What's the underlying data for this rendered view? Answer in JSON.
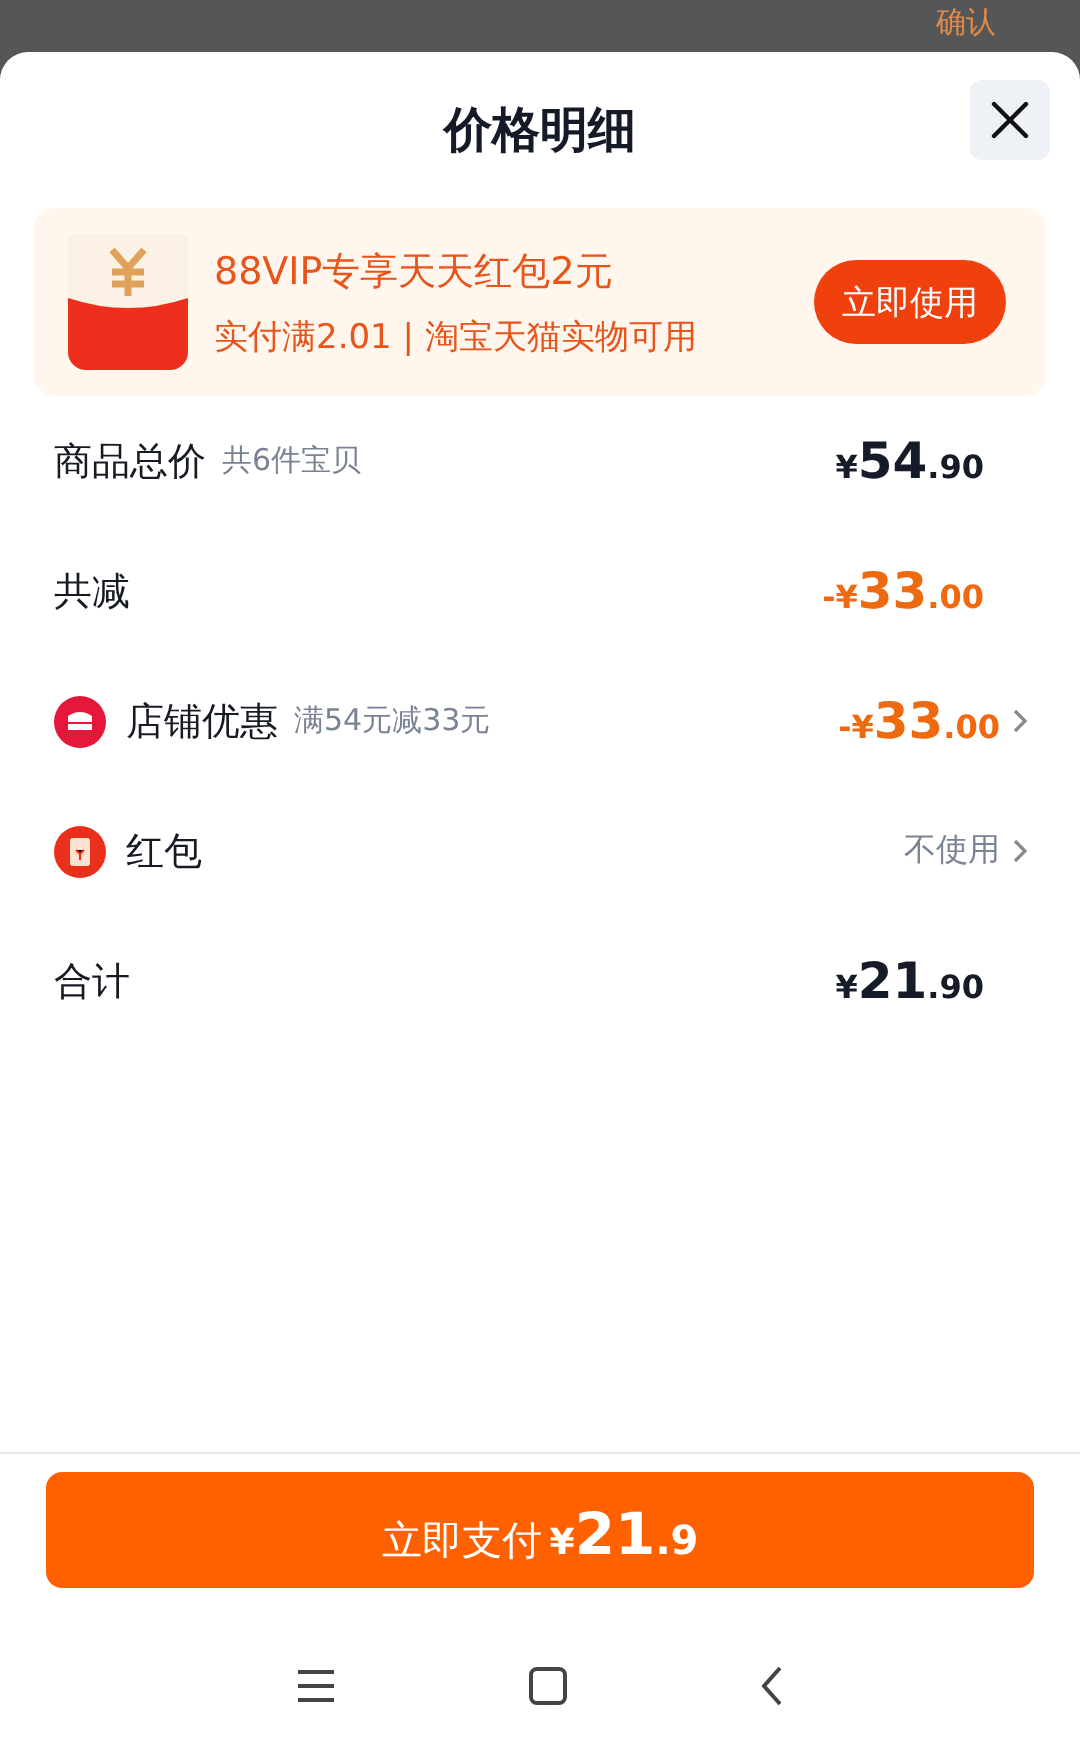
{
  "background": {
    "confirm": "确认"
  },
  "sheet": {
    "title": "价格明细"
  },
  "promo": {
    "title": "88VIP专享天天红包2元",
    "detail": "实付满2.01 | 淘宝天猫实物可用",
    "button": "立即使用"
  },
  "rows": [
    {
      "kind": "plain",
      "label": "商品总价",
      "note": "共6件宝贝",
      "amount": {
        "prefix": "¥",
        "int": "54",
        "dec": ".90"
      }
    },
    {
      "kind": "discount",
      "label": "共减",
      "amount": {
        "prefix": "-¥",
        "int": "33",
        "dec": ".00"
      }
    },
    {
      "kind": "shop_discount",
      "label": "店铺优惠",
      "note": "满54元减33元",
      "amount": {
        "prefix": "-¥",
        "int": "33",
        "dec": ".00"
      }
    },
    {
      "kind": "packet_option",
      "label": "红包",
      "value": "不使用"
    },
    {
      "kind": "plain",
      "label": "合计",
      "amount": {
        "prefix": "¥",
        "int": "21",
        "dec": ".90"
      }
    }
  ],
  "pay_button": {
    "label": "立即支付",
    "prefix": "¥",
    "int": "21",
    "dec": ".9"
  }
}
